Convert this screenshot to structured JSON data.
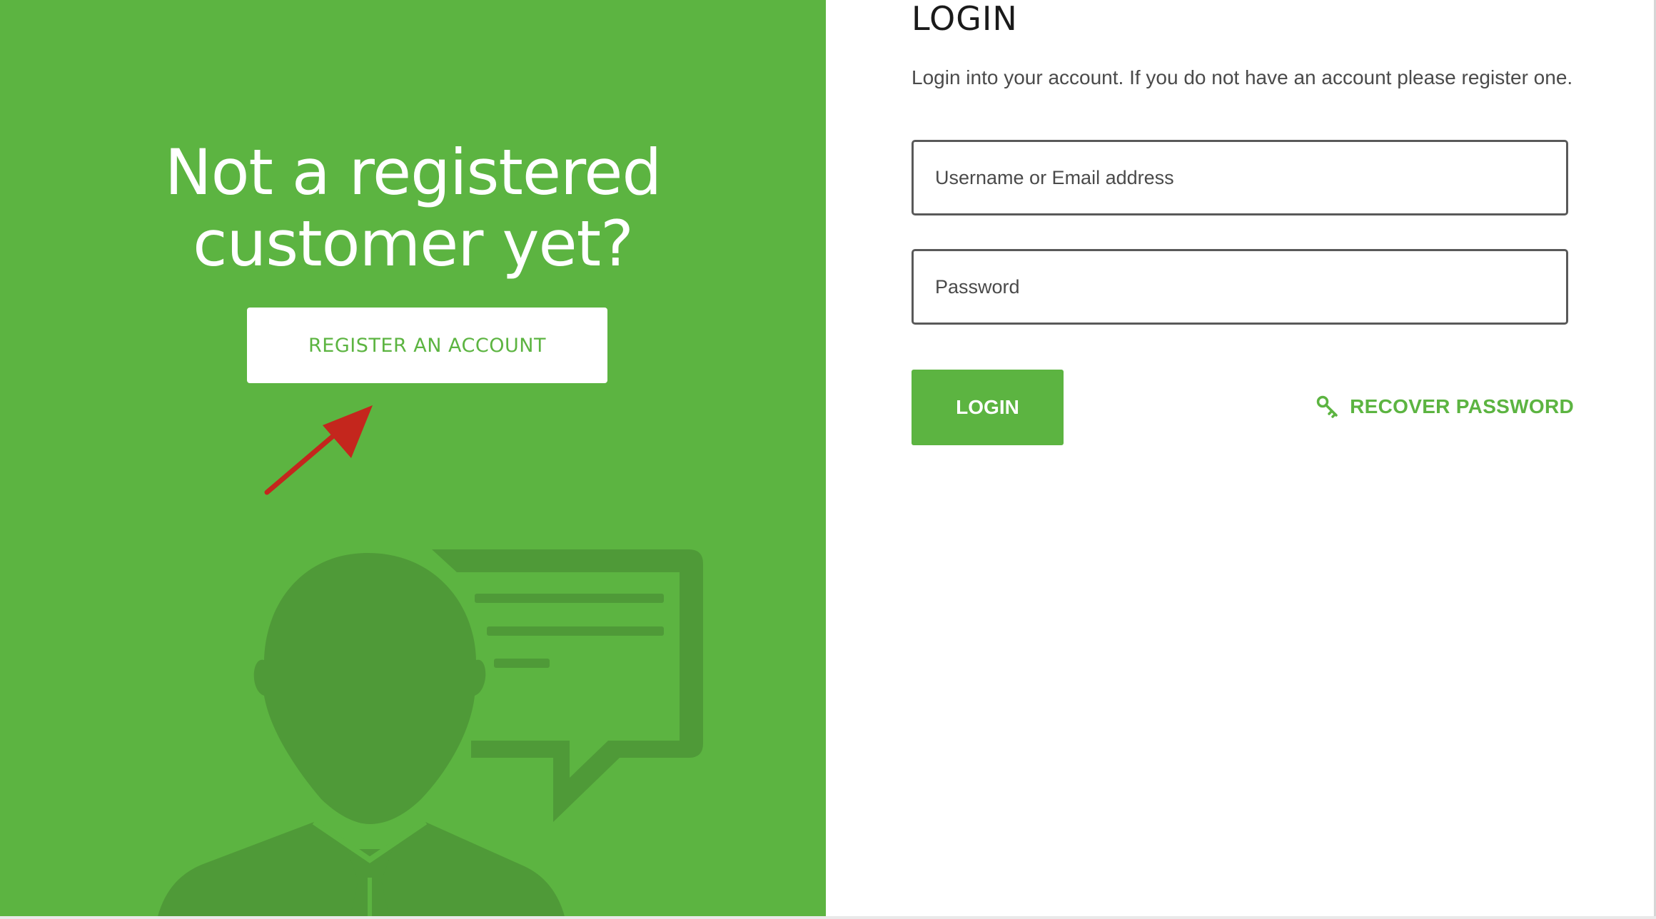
{
  "left_panel": {
    "heading_line1": "Not a registered",
    "heading_line2": "customer yet?",
    "register_button_label": "REGISTER AN ACCOUNT",
    "accent_color": "#5cb441",
    "illustration_icon": "person-speech-bubble-icon",
    "annotation_icon": "red-arrow-icon"
  },
  "login_panel": {
    "title": "LOGIN",
    "description": "Login into your account. If you do not have an account please register one.",
    "username_placeholder": "Username or Email address",
    "password_placeholder": "Password",
    "login_button_label": "LOGIN",
    "recover_link_label": "RECOVER PASSWORD",
    "recover_icon": "key-icon"
  }
}
